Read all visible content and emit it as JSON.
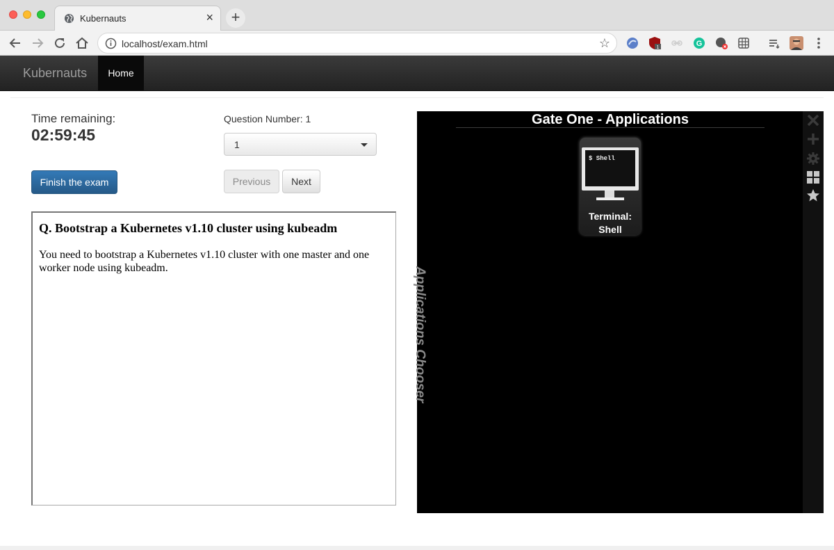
{
  "browser": {
    "tab_title": "Kubernauts",
    "url": "localhost/exam.html",
    "extension_badge": "1"
  },
  "navbar": {
    "brand": "Kubernauts",
    "home_label": "Home"
  },
  "exam": {
    "time_label": "Time remaining:",
    "time_value": "02:59:45",
    "finish_label": "Finish the exam",
    "question_number_label": "Question Number: 1",
    "question_select_value": "1",
    "previous_label": "Previous",
    "next_label": "Next"
  },
  "question": {
    "title": "Q. Bootstrap a Kubernetes v1.10 cluster using kubeadm",
    "body": "You need to bootstrap a Kubernetes v1.10 cluster with one master and one worker node using kubeadm."
  },
  "gateone": {
    "title": "Gate One - Applications",
    "tile_prompt": "$ Shell",
    "tile_label_line1": "Terminal:",
    "tile_label_line2": "Shell",
    "sidebar_label": "Applications Chooser",
    "sidebar_icons": [
      "close-icon",
      "plus-icon",
      "gear-icon",
      "grid-icon",
      "star-icon"
    ]
  }
}
